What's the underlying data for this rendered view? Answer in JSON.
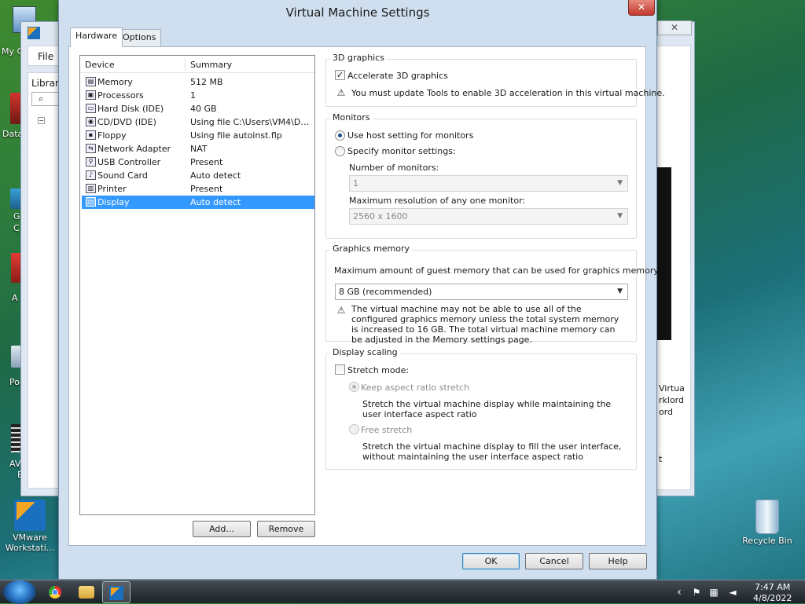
{
  "desktop": {
    "icons": [
      {
        "label": "My C",
        "x": "left"
      },
      {
        "label": "Data"
      },
      {
        "label": "G"
      },
      {
        "label": "C"
      },
      {
        "label": "A"
      },
      {
        "label": "Po"
      },
      {
        "label": "AV"
      },
      {
        "label": "E"
      }
    ],
    "vmware_label_line1": "VMware",
    "vmware_label_line2": "Workstati...",
    "recycle_bin": "Recycle Bin"
  },
  "background_window": {
    "menu_file": "File",
    "library_label": "Library",
    "close_symbol": "✕",
    "right_pane_text": [
      "Virtua",
      "rklord",
      "ord",
      "",
      "",
      "",
      "t"
    ]
  },
  "dialog": {
    "title": "Virtual Machine Settings",
    "close_symbol": "✕",
    "tabs": [
      "Hardware",
      "Options"
    ],
    "device_list": {
      "header_device": "Device",
      "header_summary": "Summary",
      "rows": [
        {
          "name": "Memory",
          "summary": "512 MB",
          "icon": "memory-icon"
        },
        {
          "name": "Processors",
          "summary": "1",
          "icon": "processor-icon"
        },
        {
          "name": "Hard Disk (IDE)",
          "summary": "40 GB",
          "icon": "hard-disk-icon"
        },
        {
          "name": "CD/DVD (IDE)",
          "summary": "Using file C:\\Users\\VM4\\Dow...",
          "icon": "cd-dvd-icon"
        },
        {
          "name": "Floppy",
          "summary": "Using file autoinst.flp",
          "icon": "floppy-icon"
        },
        {
          "name": "Network Adapter",
          "summary": "NAT",
          "icon": "network-adapter-icon"
        },
        {
          "name": "USB Controller",
          "summary": "Present",
          "icon": "usb-icon"
        },
        {
          "name": "Sound Card",
          "summary": "Auto detect",
          "icon": "sound-card-icon"
        },
        {
          "name": "Printer",
          "summary": "Present",
          "icon": "printer-icon"
        },
        {
          "name": "Display",
          "summary": "Auto detect",
          "icon": "display-icon",
          "selected": true
        }
      ]
    },
    "add_button": "Add...",
    "remove_button": "Remove",
    "graphics3d": {
      "title": "3D graphics",
      "accelerate_label": "Accelerate 3D graphics",
      "accelerate_checked": true,
      "warning": "You must update Tools to enable 3D acceleration in this virtual machine."
    },
    "monitors": {
      "title": "Monitors",
      "host_setting": "Use host setting for monitors",
      "specify": "Specify monitor settings:",
      "number_label": "Number of monitors:",
      "number_value": "1",
      "resolution_label": "Maximum resolution of any one monitor:",
      "resolution_value": "2560 x 1600"
    },
    "graphics_memory": {
      "title": "Graphics memory",
      "label": "Maximum amount of guest memory that can be used for graphics memory:",
      "value": "8 GB (recommended)",
      "warning": "The virtual machine may not be able to use all of the configured graphics memory unless the total system memory is increased to 16 GB. The total virtual machine memory can be adjusted in the Memory settings page."
    },
    "display_scaling": {
      "title": "Display scaling",
      "stretch_label": "Stretch mode:",
      "keep_aspect": "Keep aspect ratio stretch",
      "keep_aspect_desc": "Stretch the virtual machine display while maintaining the user interface aspect ratio",
      "free_stretch": "Free stretch",
      "free_stretch_desc": "Stretch the virtual machine display to fill the user interface, without maintaining the user interface aspect ratio"
    },
    "ok_button": "OK",
    "cancel_button": "Cancel",
    "help_button": "Help"
  },
  "taskbar": {
    "time": "7:47 AM",
    "date": "4/8/2022",
    "tray_chevron": "‹"
  }
}
